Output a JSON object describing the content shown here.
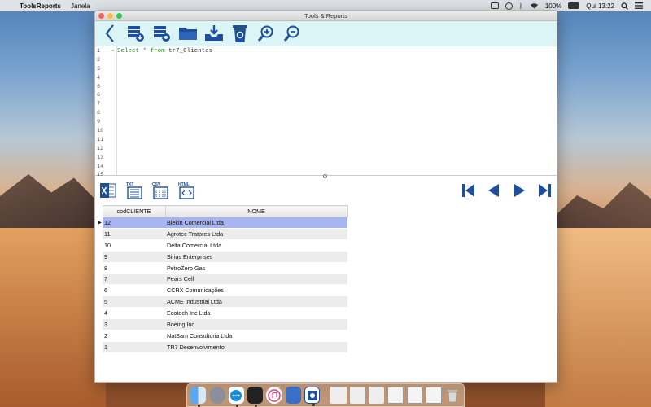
{
  "menubar": {
    "app_name": "ToolsReports",
    "menu_items": [
      "Janela"
    ],
    "battery": "100%",
    "clock": "Qui 13:22"
  },
  "window": {
    "title": "Tools & Reports"
  },
  "editor": {
    "line_numbers": [
      "1",
      "2",
      "3",
      "4",
      "5",
      "6",
      "7",
      "8",
      "9",
      "10",
      "11",
      "12",
      "13",
      "14",
      "15"
    ],
    "sql_keyword_select": "Select",
    "sql_star": "*",
    "sql_keyword_from": "from",
    "sql_table": "tr7_Clientes"
  },
  "export": {
    "txt_label": "TXT",
    "csv_label": "CSV",
    "html_label": "HTML"
  },
  "grid": {
    "columns": [
      "codCLIENTE",
      "NOME"
    ],
    "current_row_marker": "▶",
    "rows": [
      {
        "cod": "12",
        "nome": "Blekin Comercial Ltda"
      },
      {
        "cod": "11",
        "nome": "Agrotec Tratores Ltda"
      },
      {
        "cod": "10",
        "nome": "Delta Comercial Ltda"
      },
      {
        "cod": "9",
        "nome": "Sirius Enterprises"
      },
      {
        "cod": "8",
        "nome": "PetroZero Gas"
      },
      {
        "cod": "7",
        "nome": "Pears Cell"
      },
      {
        "cod": "6",
        "nome": "CCRX Comunicações"
      },
      {
        "cod": "5",
        "nome": "ACME Industrial Ltda"
      },
      {
        "cod": "4",
        "nome": "Ecotech Inc Ltda"
      },
      {
        "cod": "3",
        "nome": "Boeing Inc"
      },
      {
        "cod": "2",
        "nome": "NatSam Consultoria Ltda"
      },
      {
        "cod": "1",
        "nome": "TR7 Desenvolvimento"
      }
    ]
  },
  "colors": {
    "toolbar_bg": "#dbf5f7",
    "icon_blue": "#1f4f9c",
    "selected_row": "#a6b4f0",
    "sql_keyword": "#2e8b2e"
  }
}
